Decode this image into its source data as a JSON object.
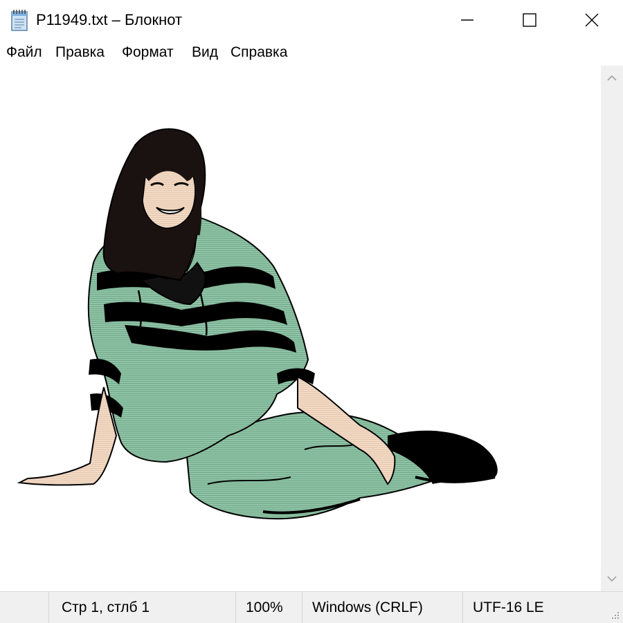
{
  "window": {
    "title": "P11949.txt – Блокнот"
  },
  "menu": {
    "items": [
      "Файл",
      "Правка",
      "Формат",
      "Вид",
      "Справка"
    ]
  },
  "icons": {
    "app": "notepad-icon",
    "minimize": "minimize-icon",
    "maximize": "maximize-icon",
    "close": "close-icon",
    "scroll_up": "chevron-up-icon",
    "scroll_down": "chevron-down-icon",
    "grip": "resize-grip-icon"
  },
  "editor": {
    "image_description": "ASCII-art style illustration of a smiling woman with long dark hair sitting on the floor, wearing a mint-green sweater with black stripes and mint-green pants"
  },
  "statusbar": {
    "position": "Стр 1, стлб 1",
    "zoom": "100%",
    "line_ending": "Windows (CRLF)",
    "encoding": "UTF-16 LE"
  },
  "colors": {
    "garment": "#8fc4a6",
    "skin": "#f2d9c4",
    "hair": "#1a1210",
    "stripes": "#000000",
    "statusbar_bg": "#f0f0f0"
  }
}
